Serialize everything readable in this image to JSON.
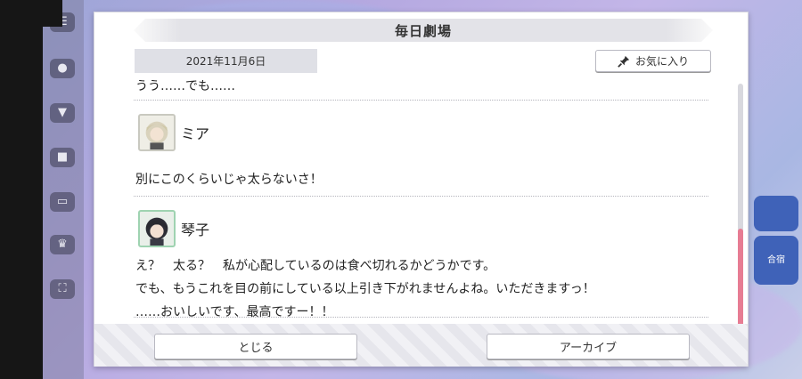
{
  "dialog": {
    "title": "毎日劇場",
    "date": "2021年11月6日",
    "favorite_label": "お気に入り",
    "close_label": "とじる",
    "archive_label": "アーカイブ"
  },
  "script": {
    "cut_line": "うう……でも……",
    "entries": [
      {
        "speaker": "ミア",
        "lines": [
          "別にこのくらいじゃ太らないさ！"
        ]
      },
      {
        "speaker": "琴子",
        "lines": [
          "え？　太る？　私が心配しているのは食べ切れるかどうかです。",
          "でも、もうこれを目の前にしている以上引き下がれませんよね。いただきますっ！",
          "……おいしいです、最高ですー！！"
        ]
      }
    ]
  },
  "background": {
    "right_tile_label": "合宿"
  },
  "scroll": {
    "position": 1.0
  },
  "colors": {
    "scroll_thumb": "#e77c93",
    "avatar_border": "#9fd3b1",
    "rail_tile": "#3f62b8"
  },
  "icons": [
    "pin-icon",
    "menu-icon",
    "chat-icon",
    "gift-icon",
    "monitor-icon",
    "trophy-icon",
    "fullscreen-icon"
  ]
}
